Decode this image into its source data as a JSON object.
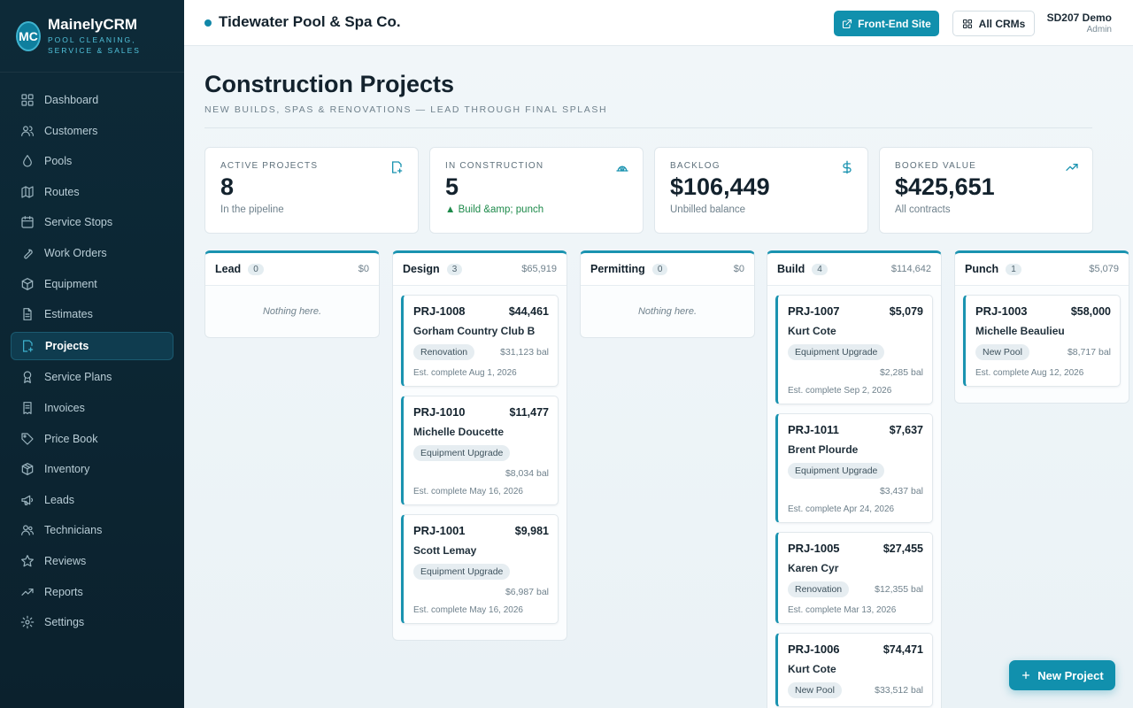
{
  "brand": {
    "logo": "MC",
    "name": "MainelyCRM",
    "tag_line1": "POOL CLEANING,",
    "tag_line2": "SERVICE & SALES"
  },
  "nav": [
    {
      "label": "Dashboard",
      "icon": "grid-icon"
    },
    {
      "label": "Customers",
      "icon": "users-icon"
    },
    {
      "label": "Pools",
      "icon": "droplet-icon"
    },
    {
      "label": "Routes",
      "icon": "map-icon"
    },
    {
      "label": "Service Stops",
      "icon": "calendar-icon"
    },
    {
      "label": "Work Orders",
      "icon": "wrench-icon"
    },
    {
      "label": "Equipment",
      "icon": "box-icon"
    },
    {
      "label": "Estimates",
      "icon": "document-icon"
    },
    {
      "label": "Projects",
      "icon": "hardhat-icon",
      "active": true
    },
    {
      "label": "Service Plans",
      "icon": "award-icon"
    },
    {
      "label": "Invoices",
      "icon": "receipt-icon"
    },
    {
      "label": "Price Book",
      "icon": "tag-icon"
    },
    {
      "label": "Inventory",
      "icon": "package-icon"
    },
    {
      "label": "Leads",
      "icon": "megaphone-icon"
    },
    {
      "label": "Technicians",
      "icon": "user-group-icon"
    },
    {
      "label": "Reviews",
      "icon": "star-icon"
    },
    {
      "label": "Reports",
      "icon": "trending-icon"
    },
    {
      "label": "Settings",
      "icon": "gear-icon"
    }
  ],
  "topbar": {
    "company": "Tidewater Pool & Spa Co.",
    "front_end": "Front-End Site",
    "all_crms": "All CRMs",
    "user_name": "SD207 Demo",
    "user_role": "Admin"
  },
  "page": {
    "title": "Construction Projects",
    "subtitle": "NEW BUILDS, SPAS & RENOVATIONS — LEAD THROUGH FINAL SPLASH"
  },
  "stats": [
    {
      "label": "ACTIVE PROJECTS",
      "value": "8",
      "sub": "In the pipeline",
      "icon": "hardhat-icon"
    },
    {
      "label": "IN CONSTRUCTION",
      "value": "5",
      "sub": "▲ Build &amp; punch",
      "icon": "construction-icon"
    },
    {
      "label": "BACKLOG",
      "value": "$106,449",
      "sub": "Unbilled balance",
      "icon": "dollar-icon"
    },
    {
      "label": "BOOKED VALUE",
      "value": "$425,651",
      "sub": "All contracts",
      "icon": "trending-up-icon"
    }
  ],
  "columns": [
    {
      "name": "Lead",
      "count": "0",
      "total": "$0",
      "empty": "Nothing here.",
      "cards": []
    },
    {
      "name": "Design",
      "count": "3",
      "total": "$65,919",
      "cards": [
        {
          "id": "PRJ-1008",
          "amount": "$44,461",
          "customer": "Gorham Country Club B",
          "tag": "Renovation",
          "bal": "$31,123 bal",
          "est": "Est. complete Aug 1, 2026"
        },
        {
          "id": "PRJ-1010",
          "amount": "$11,477",
          "customer": "Michelle Doucette",
          "tag": "Equipment Upgrade",
          "bal": "$8,034 bal",
          "est": "Est. complete May 16, 2026"
        },
        {
          "id": "PRJ-1001",
          "amount": "$9,981",
          "customer": "Scott Lemay",
          "tag": "Equipment Upgrade",
          "bal": "$6,987 bal",
          "est": "Est. complete May 16, 2026"
        }
      ]
    },
    {
      "name": "Permitting",
      "count": "0",
      "total": "$0",
      "empty": "Nothing here.",
      "cards": []
    },
    {
      "name": "Build",
      "count": "4",
      "total": "$114,642",
      "cards": [
        {
          "id": "PRJ-1007",
          "amount": "$5,079",
          "customer": "Kurt Cote",
          "tag": "Equipment Upgrade",
          "bal": "$2,285 bal",
          "est": "Est. complete Sep 2, 2026"
        },
        {
          "id": "PRJ-1011",
          "amount": "$7,637",
          "customer": "Brent Plourde",
          "tag": "Equipment Upgrade",
          "bal": "$3,437 bal",
          "est": "Est. complete Apr 24, 2026"
        },
        {
          "id": "PRJ-1005",
          "amount": "$27,455",
          "customer": "Karen Cyr",
          "tag": "Renovation",
          "bal": "$12,355 bal",
          "est": "Est. complete Mar 13, 2026"
        },
        {
          "id": "PRJ-1006",
          "amount": "$74,471",
          "customer": "Kurt Cote",
          "tag": "New Pool",
          "bal": "$33,512 bal",
          "est": ""
        }
      ]
    },
    {
      "name": "Punch",
      "count": "1",
      "total": "$5,079",
      "cards": [
        {
          "id": "PRJ-1003",
          "amount": "$58,000",
          "customer": "Michelle Beaulieu",
          "tag": "New Pool",
          "bal": "$8,717 bal",
          "est": "Est. complete Aug 12, 2026"
        }
      ]
    }
  ],
  "fab": {
    "label": "New Project"
  },
  "colors": {
    "accent": "#1190ad",
    "sidebar": "#0d2a38",
    "success": "#1d8a4a"
  }
}
